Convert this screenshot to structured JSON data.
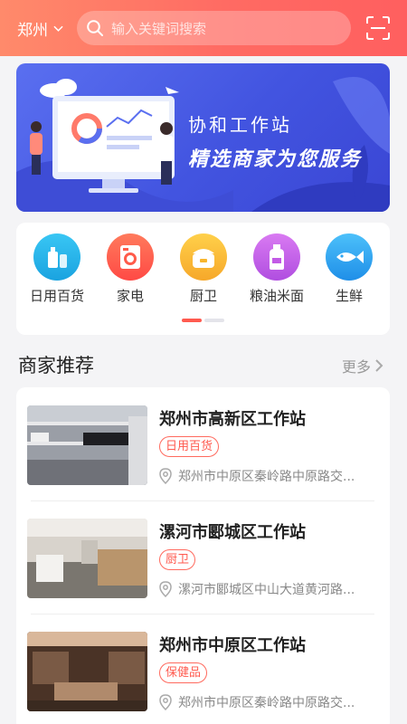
{
  "header": {
    "city": "郑州",
    "search_placeholder": "输入关键词搜索",
    "scan_icon": "scan-icon"
  },
  "banner": {
    "title": "协和工作站",
    "slogan": "精选商家为您服务"
  },
  "categories": [
    {
      "label": "日用百货",
      "icon": "bottle-icon",
      "color": "#22b3e8"
    },
    {
      "label": "家电",
      "icon": "washing-machine-icon",
      "color": "#ff5b4a"
    },
    {
      "label": "厨卫",
      "icon": "rice-cooker-icon",
      "color": "#f8b62d"
    },
    {
      "label": "粮油米面",
      "icon": "oil-bottle-icon",
      "color": "#c25ae6"
    },
    {
      "label": "生鲜",
      "icon": "fish-icon",
      "color": "#2ea6f2"
    }
  ],
  "section": {
    "title": "商家推荐",
    "more": "更多"
  },
  "merchants": [
    {
      "name": "郑州市高新区工作站",
      "tag": "日用百货",
      "address": "郑州市中原区秦岭路中原路交..."
    },
    {
      "name": "漯河市郾城区工作站",
      "tag": "厨卫",
      "address": "漯河市郾城区中山大道黄河路..."
    },
    {
      "name": "郑州市中原区工作站",
      "tag": "保健品",
      "address": "郑州市中原区秦岭路中原路交..."
    }
  ],
  "colors": {
    "accent": "#ff5a4f",
    "header_start": "#ff8a6b",
    "banner": "#4a5ce6"
  }
}
